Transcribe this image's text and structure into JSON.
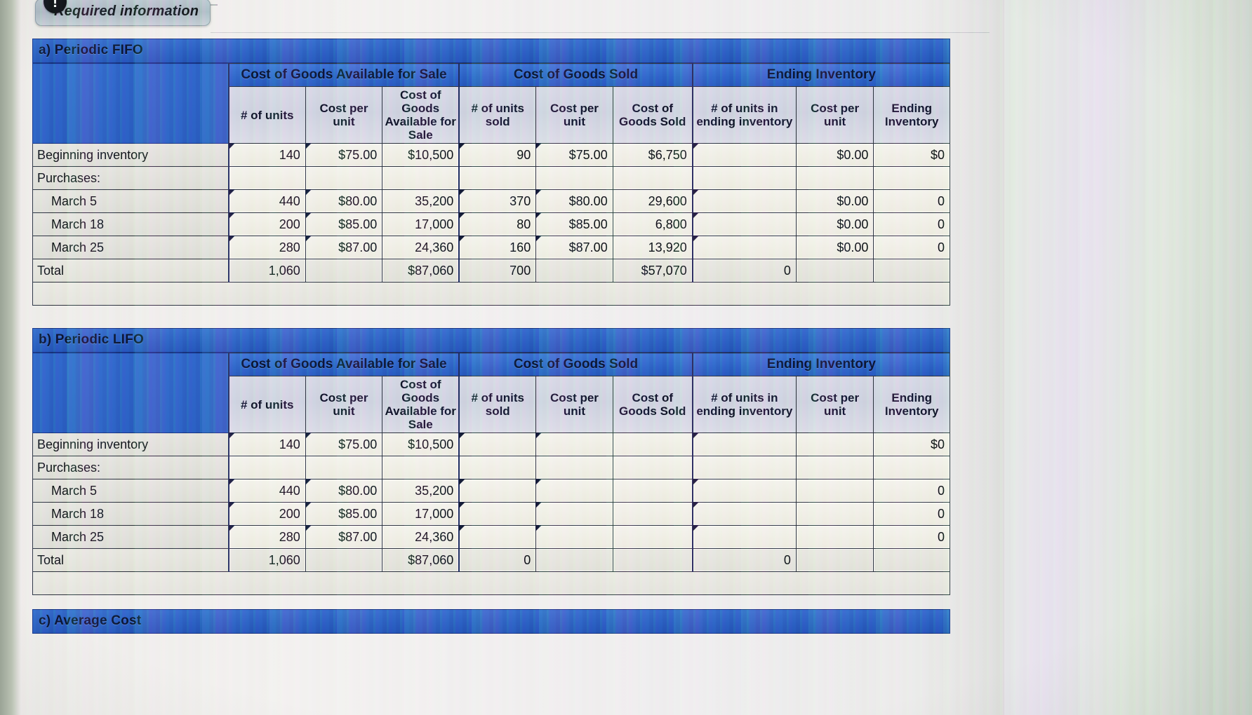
{
  "banner": {
    "icon": "exclamation-icon",
    "label": "Required information"
  },
  "columns": {
    "group_cogafs": "Cost of Goods Available for Sale",
    "group_cogs": "Cost of Goods Sold",
    "group_ei": "Ending Inventory",
    "units_available": "# of units",
    "cost_per_unit_available": "Cost per unit",
    "cogafs": "Cost of Goods Available for Sale",
    "units_sold": "# of units sold",
    "cost_per_unit_sold": "Cost per unit",
    "cogs": "Cost of Goods Sold",
    "units_ending": "# of units in ending inventory",
    "cost_per_unit_ending": "Cost per unit",
    "ending_inventory": "Ending Inventory"
  },
  "sections": [
    {
      "id": "periodic-fifo",
      "title": "a) Periodic FIFO",
      "rows": [
        {
          "label": "Beginning inventory",
          "indent": false,
          "units_available": "140",
          "cpu_available_sym": "$",
          "cpu_available": "75.00",
          "cogafs_sym": "$",
          "cogafs": "10,500",
          "units_sold": "90",
          "cpu_sold_sym": "$",
          "cpu_sold": "75.00",
          "cogs_sym": "$",
          "cogs": "6,750",
          "units_ending": "",
          "cpu_ending_sym": "$",
          "cpu_ending": "0.00",
          "ei_sym": "$",
          "ei": "0"
        },
        {
          "label": "Purchases:",
          "indent": false,
          "units_available": "",
          "cpu_available_sym": "",
          "cpu_available": "",
          "cogafs_sym": "",
          "cogafs": "",
          "units_sold": "",
          "cpu_sold_sym": "",
          "cpu_sold": "",
          "cogs_sym": "",
          "cogs": "",
          "units_ending": "",
          "cpu_ending_sym": "",
          "cpu_ending": "",
          "ei_sym": "",
          "ei": ""
        },
        {
          "label": "March 5",
          "indent": true,
          "units_available": "440",
          "cpu_available_sym": "$",
          "cpu_available": "80.00",
          "cogafs_sym": "",
          "cogafs": "35,200",
          "units_sold": "370",
          "cpu_sold_sym": "$",
          "cpu_sold": "80.00",
          "cogs_sym": "",
          "cogs": "29,600",
          "units_ending": "",
          "cpu_ending_sym": "$",
          "cpu_ending": "0.00",
          "ei_sym": "",
          "ei": "0"
        },
        {
          "label": "March 18",
          "indent": true,
          "units_available": "200",
          "cpu_available_sym": "$",
          "cpu_available": "85.00",
          "cogafs_sym": "",
          "cogafs": "17,000",
          "units_sold": "80",
          "cpu_sold_sym": "$",
          "cpu_sold": "85.00",
          "cogs_sym": "",
          "cogs": "6,800",
          "units_ending": "",
          "cpu_ending_sym": "$",
          "cpu_ending": "0.00",
          "ei_sym": "",
          "ei": "0"
        },
        {
          "label": "March 25",
          "indent": true,
          "units_available": "280",
          "cpu_available_sym": "$",
          "cpu_available": "87.00",
          "cogafs_sym": "",
          "cogafs": "24,360",
          "units_sold": "160",
          "cpu_sold_sym": "$",
          "cpu_sold": "87.00",
          "cogs_sym": "",
          "cogs": "13,920",
          "units_ending": "",
          "cpu_ending_sym": "$",
          "cpu_ending": "0.00",
          "ei_sym": "",
          "ei": "0"
        }
      ],
      "total": {
        "label": "Total",
        "units_available": "1,060",
        "cpu_available_sym": "",
        "cpu_available": "",
        "cogafs_sym": "$",
        "cogafs": "87,060",
        "units_sold": "700",
        "cpu_sold_sym": "",
        "cpu_sold": "",
        "cogs_sym": "$",
        "cogs": "57,070",
        "units_ending": "0",
        "cpu_ending_sym": "",
        "cpu_ending": "",
        "ei_sym": "",
        "ei": "",
        "ei_highlight": true
      }
    },
    {
      "id": "periodic-lifo",
      "title": "b) Periodic LIFO",
      "rows": [
        {
          "label": "Beginning inventory",
          "indent": false,
          "units_available": "140",
          "cpu_available_sym": "$",
          "cpu_available": "75.00",
          "cogafs_sym": "$",
          "cogafs": "10,500",
          "units_sold": "",
          "cpu_sold_sym": "",
          "cpu_sold": "",
          "cogs_sym": "",
          "cogs": "",
          "units_ending": "",
          "cpu_ending_sym": "",
          "cpu_ending": "",
          "ei_sym": "$",
          "ei": "0"
        },
        {
          "label": "Purchases:",
          "indent": false,
          "units_available": "",
          "cpu_available_sym": "",
          "cpu_available": "",
          "cogafs_sym": "",
          "cogafs": "",
          "units_sold": "",
          "cpu_sold_sym": "",
          "cpu_sold": "",
          "cogs_sym": "",
          "cogs": "",
          "units_ending": "",
          "cpu_ending_sym": "",
          "cpu_ending": "",
          "ei_sym": "",
          "ei": ""
        },
        {
          "label": "March 5",
          "indent": true,
          "units_available": "440",
          "cpu_available_sym": "$",
          "cpu_available": "80.00",
          "cogafs_sym": "",
          "cogafs": "35,200",
          "units_sold": "",
          "cpu_sold_sym": "",
          "cpu_sold": "",
          "cogs_sym": "",
          "cogs": "",
          "units_ending": "",
          "cpu_ending_sym": "",
          "cpu_ending": "",
          "ei_sym": "",
          "ei": "0"
        },
        {
          "label": "March 18",
          "indent": true,
          "units_available": "200",
          "cpu_available_sym": "$",
          "cpu_available": "85.00",
          "cogafs_sym": "",
          "cogafs": "17,000",
          "units_sold": "",
          "cpu_sold_sym": "",
          "cpu_sold": "",
          "cogs_sym": "",
          "cogs": "",
          "units_ending": "",
          "cpu_ending_sym": "",
          "cpu_ending": "",
          "ei_sym": "",
          "ei": "0"
        },
        {
          "label": "March 25",
          "indent": true,
          "units_available": "280",
          "cpu_available_sym": "$",
          "cpu_available": "87.00",
          "cogafs_sym": "",
          "cogafs": "24,360",
          "units_sold": "",
          "cpu_sold_sym": "",
          "cpu_sold": "",
          "cogs_sym": "",
          "cogs": "",
          "units_ending": "",
          "cpu_ending_sym": "",
          "cpu_ending": "",
          "ei_sym": "",
          "ei": "0"
        }
      ],
      "total": {
        "label": "Total",
        "units_available": "1,060",
        "cpu_available_sym": "",
        "cpu_available": "",
        "cogafs_sym": "$",
        "cogafs": "87,060",
        "units_sold": "0",
        "cpu_sold_sym": "",
        "cpu_sold": "",
        "cogs_sym": "",
        "cogs": "",
        "units_ending": "0",
        "cpu_ending_sym": "",
        "cpu_ending": "",
        "ei_sym": "",
        "ei": "",
        "ei_highlight": false
      }
    }
  ],
  "section_c": {
    "title": "c) Average Cost"
  },
  "colors": {
    "header_blue": "#2b5fc2",
    "title_blue": "#2a5cbd",
    "grid": "#2b2f38",
    "highlight_yellow": "#e3dcb0"
  }
}
